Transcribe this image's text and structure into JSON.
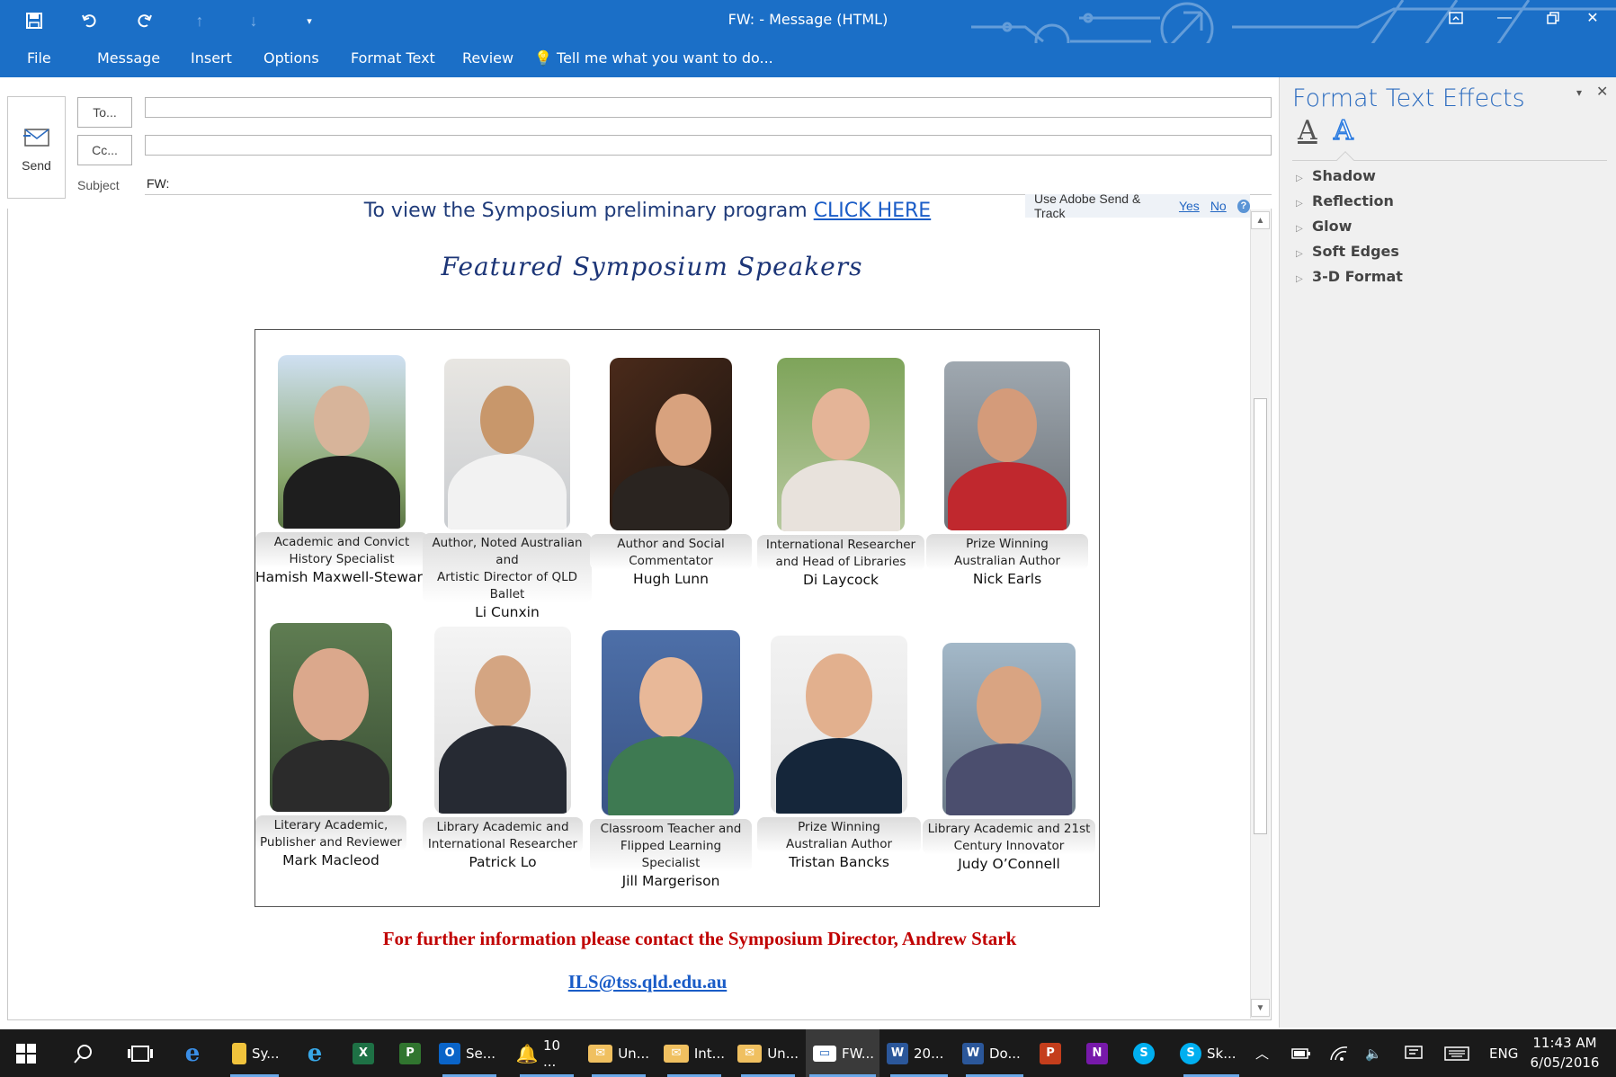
{
  "window": {
    "title": "FW:  - Message (HTML)",
    "accent": "#1b6fc7"
  },
  "quick_access": [
    "save-icon",
    "undo-icon",
    "redo-icon",
    "up-arrow-icon",
    "down-arrow-icon",
    "customize-icon"
  ],
  "ribbon": {
    "tabs": [
      "File",
      "Message",
      "Insert",
      "Options",
      "Format Text",
      "Review"
    ],
    "tell_me": "Tell me what you want to do..."
  },
  "compose": {
    "send_label": "Send",
    "to_label": "To...",
    "cc_label": "Cc...",
    "subject_label": "Subject",
    "subject_value": "FW:"
  },
  "adobe_bar": {
    "text": "Use Adobe Send & Track",
    "yes": "Yes",
    "no": "No",
    "help": "?"
  },
  "message": {
    "program_text": "To view the Symposium preliminary program",
    "program_link": "CLICK HERE",
    "featured_heading": "Featured Symposium Speakers",
    "speakers": [
      {
        "caption1": "Academic and Convict",
        "caption2": "History Specialist",
        "name": "Hamish Maxwell-Stewart"
      },
      {
        "caption1": "Author, Noted Australian and",
        "caption2": "Artistic Director of QLD Ballet",
        "name": "Li Cunxin"
      },
      {
        "caption1": "Author and Social",
        "caption2": "Commentator",
        "name": "Hugh Lunn"
      },
      {
        "caption1": "International Researcher",
        "caption2": "and Head of Libraries",
        "name": "Di Laycock"
      },
      {
        "caption1": "Prize Winning",
        "caption2": "Australian Author",
        "name": "Nick Earls"
      },
      {
        "caption1": "Literary Academic,",
        "caption2": "Publisher and Reviewer",
        "name": "Mark Macleod"
      },
      {
        "caption1": "Library Academic and",
        "caption2": "International Researcher",
        "name": "Patrick Lo"
      },
      {
        "caption1": "Classroom Teacher and",
        "caption2": "Flipped Learning Specialist",
        "name": "Jill Margerison"
      },
      {
        "caption1": "Prize Winning",
        "caption2": "Australian Author",
        "name": "Tristan Bancks"
      },
      {
        "caption1": "Library Academic and 21st",
        "caption2": "Century Innovator",
        "name": "Judy O’Connell"
      }
    ],
    "contact_text": "For further information please contact the Symposium Director, Andrew Stark",
    "email": "ILS@tss.qld.edu.au"
  },
  "pane": {
    "title": "Format Text Effects",
    "sections": [
      "Shadow",
      "Reflection",
      "Glow",
      "Soft Edges",
      "3-D Format"
    ]
  },
  "taskbar": {
    "items": [
      {
        "label": "Sy...",
        "icon": "file-explorer-icon"
      },
      {
        "label": "Se...",
        "icon": "outlook-icon"
      },
      {
        "label": "10 ...",
        "icon": "reminder-bell-icon"
      },
      {
        "label": "Un...",
        "icon": "mail-envelope-icon"
      },
      {
        "label": "Int...",
        "icon": "mail-envelope-icon"
      },
      {
        "label": "Un...",
        "icon": "mail-envelope-icon"
      },
      {
        "label": "FW...",
        "icon": "message-window-icon"
      },
      {
        "label": "20...",
        "icon": "word-icon"
      },
      {
        "label": "Do...",
        "icon": "word-icon"
      },
      {
        "label": "Sk...",
        "icon": "skype-icon"
      }
    ],
    "language": "ENG",
    "time": "11:43 AM",
    "date": "6/05/2016"
  }
}
